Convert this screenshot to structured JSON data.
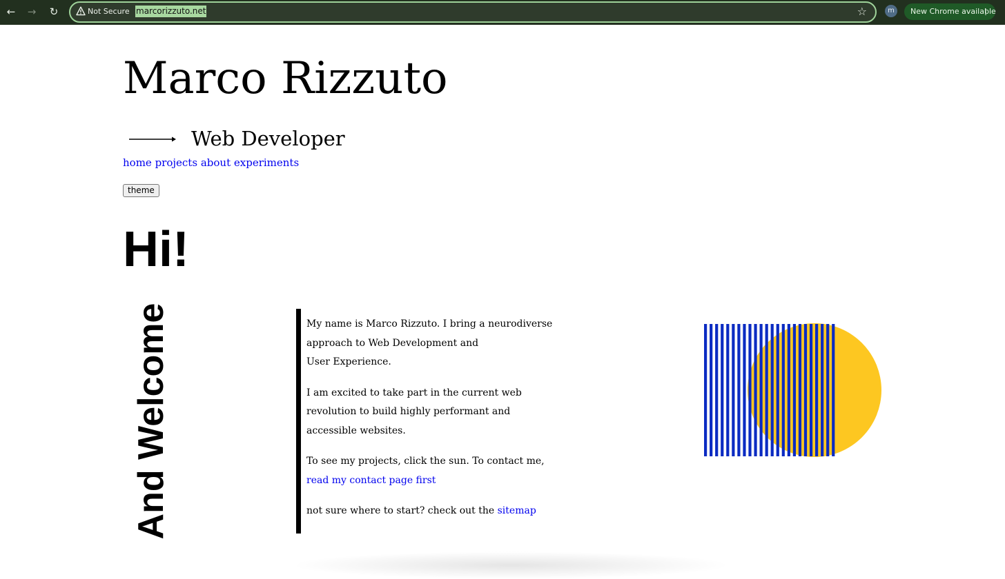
{
  "browser": {
    "security_label": "Not Secure",
    "url": "marcorizzuto.net",
    "profile_initial": "m",
    "update_label": "New Chrome available"
  },
  "site": {
    "title": "Marco Rizzuto",
    "subtitle": "Web Developer",
    "nav": [
      "home",
      "projects",
      "about",
      "experiments"
    ],
    "theme_label": "theme"
  },
  "hero": {
    "heading": "Hi!",
    "vertical_heading": "And Welcome"
  },
  "intro": {
    "p1_line1": "My name is Marco Rizzuto. I bring a neurodiverse approach to Web Development and",
    "p1_line2": "User Experience.",
    "p2": "I am excited to take part in the current web revolution to build highly performant and accessible websites.",
    "p3": "To see my projects, click the sun. To contact me,",
    "p3_link": "read my contact page first",
    "p4": "not sure where to start? check out the",
    "p4_link": "sitemap"
  },
  "colors": {
    "stripes": "#0b2bc2",
    "sun": "#fdc721",
    "link": "#0000ee"
  }
}
